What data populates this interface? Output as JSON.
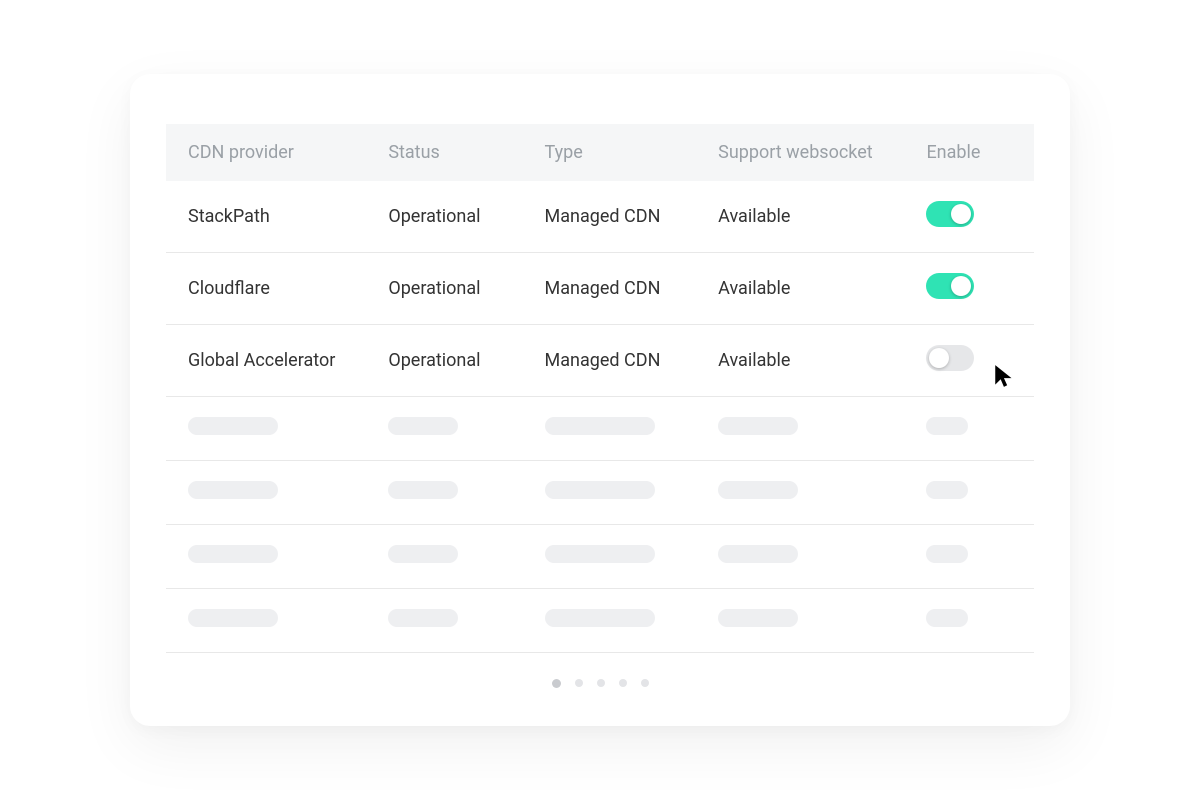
{
  "colors": {
    "toggle_on": "#2fe3b4",
    "toggle_off": "#e6e7e9",
    "header_text": "#9aa0a6",
    "cell_text": "#333333"
  },
  "table": {
    "headers": {
      "provider": "CDN provider",
      "status": "Status",
      "type": "Type",
      "websocket": "Support websocket",
      "enable": "Enable"
    },
    "rows": [
      {
        "provider": "StackPath",
        "status": "Operational",
        "type": "Managed CDN",
        "websocket": "Available",
        "enabled": true
      },
      {
        "provider": "Cloudflare",
        "status": "Operational",
        "type": "Managed CDN",
        "websocket": "Available",
        "enabled": true
      },
      {
        "provider": "Global Accelerator",
        "status": "Operational",
        "type": "Managed CDN",
        "websocket": "Available",
        "enabled": false
      }
    ],
    "placeholder_row_count": 4,
    "pagination": {
      "pages": 5,
      "current": 1
    }
  }
}
